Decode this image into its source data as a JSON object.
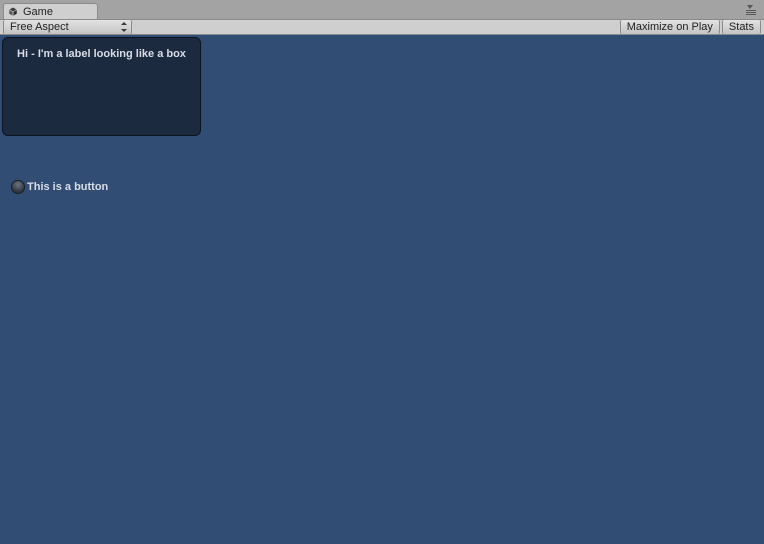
{
  "tab": {
    "title": "Game"
  },
  "toolbar": {
    "aspect_label": "Free Aspect",
    "maximize_label": "Maximize on Play",
    "stats_label": "Stats"
  },
  "viewport": {
    "box_label": "Hi - I'm a label looking like a box",
    "button_label": "This is a button"
  }
}
